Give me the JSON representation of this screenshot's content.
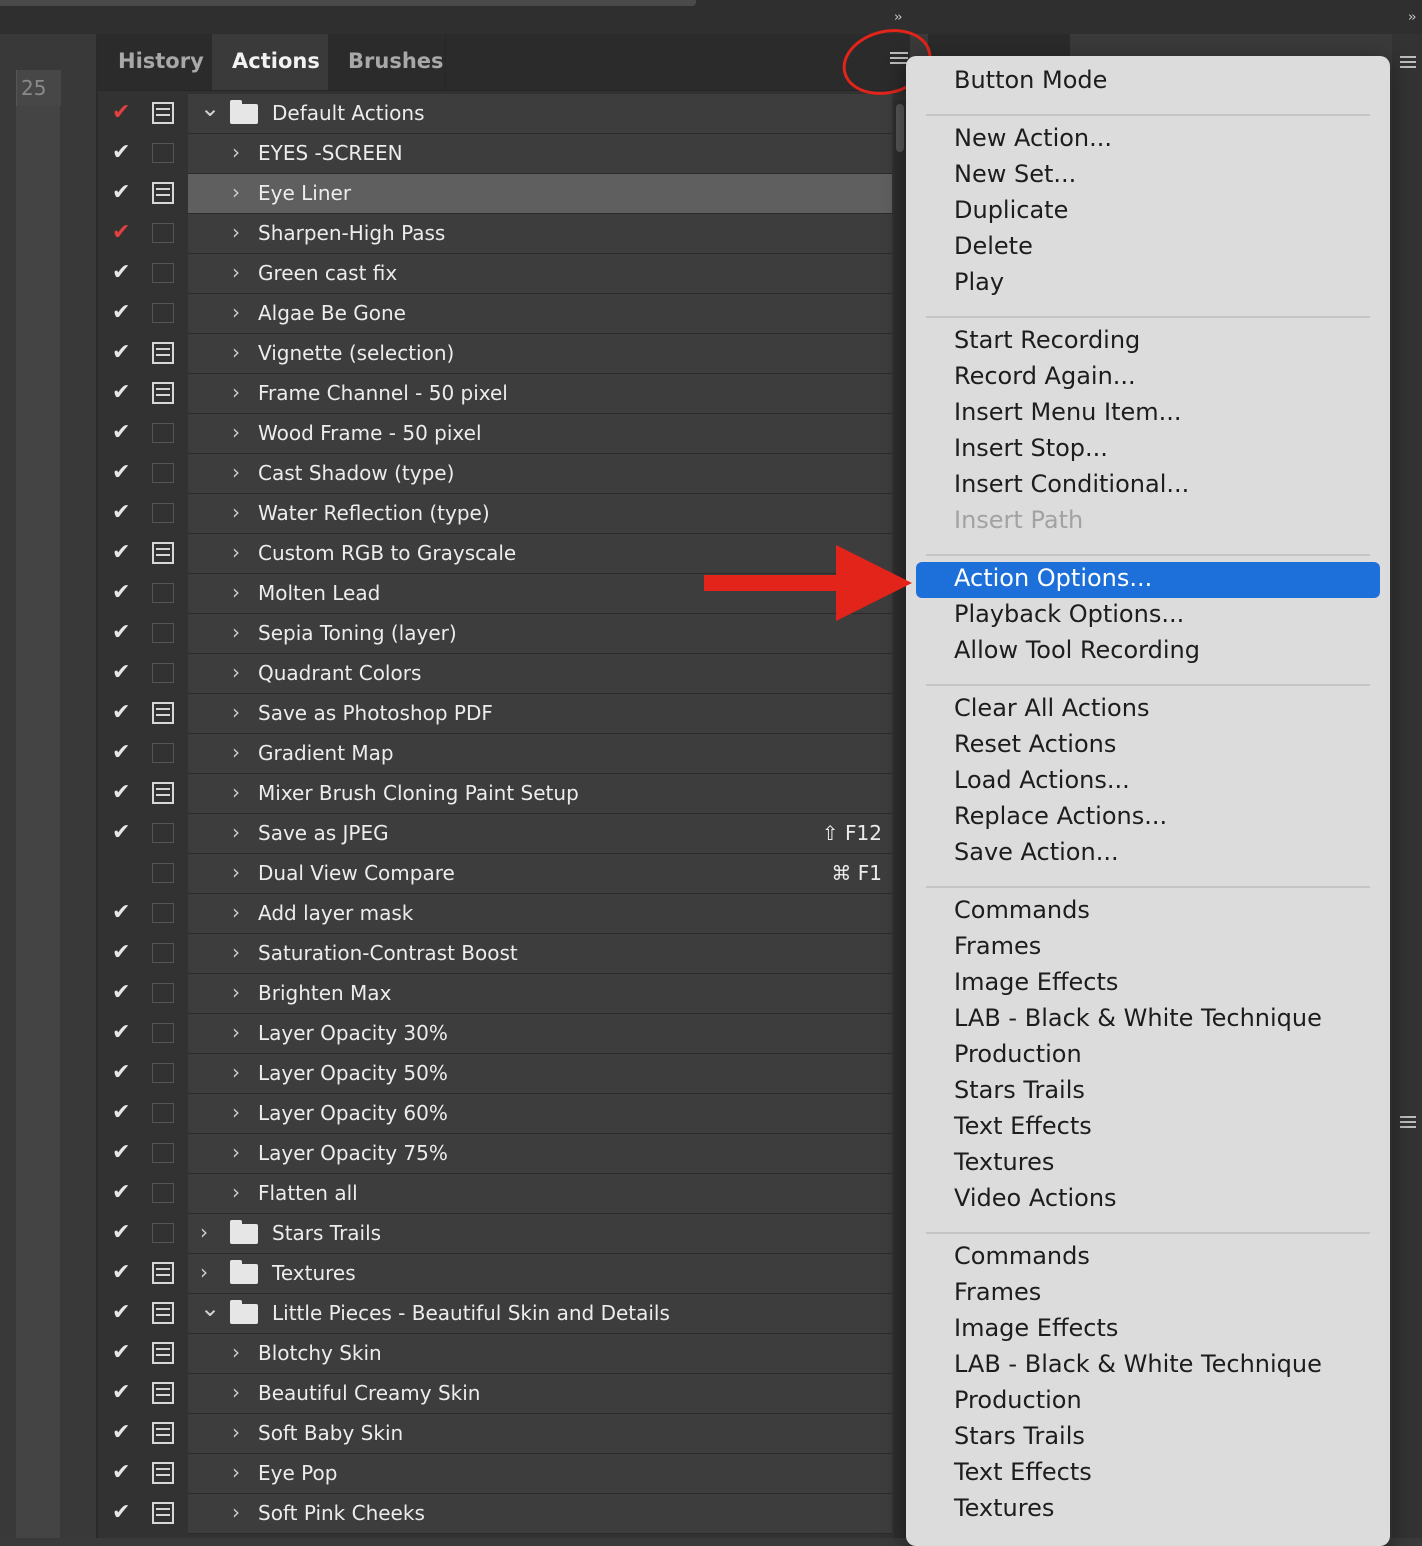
{
  "ruler": {
    "number": "25"
  },
  "tabs": [
    "History",
    "Actions",
    "Brushes"
  ],
  "actions": [
    {
      "label": "Default Actions",
      "check": "red",
      "dialog": true,
      "kind": "set",
      "open": true
    },
    {
      "label": "EYES -SCREEN",
      "check": "white",
      "dialog": false,
      "kind": "action"
    },
    {
      "label": "Eye Liner",
      "check": "white",
      "dialog": true,
      "kind": "action",
      "selected": true
    },
    {
      "label": "Sharpen-High Pass",
      "check": "red",
      "dialog": false,
      "kind": "action"
    },
    {
      "label": "Green cast fix",
      "check": "white",
      "dialog": false,
      "kind": "action"
    },
    {
      "label": "Algae Be Gone",
      "check": "white",
      "dialog": false,
      "kind": "action"
    },
    {
      "label": "Vignette (selection)",
      "check": "white",
      "dialog": true,
      "kind": "action"
    },
    {
      "label": "Frame Channel - 50 pixel",
      "check": "white",
      "dialog": true,
      "kind": "action"
    },
    {
      "label": "Wood Frame - 50 pixel",
      "check": "white",
      "dialog": false,
      "kind": "action"
    },
    {
      "label": "Cast Shadow (type)",
      "check": "white",
      "dialog": false,
      "kind": "action"
    },
    {
      "label": "Water Reflection (type)",
      "check": "white",
      "dialog": false,
      "kind": "action"
    },
    {
      "label": "Custom RGB to Grayscale",
      "check": "white",
      "dialog": true,
      "kind": "action"
    },
    {
      "label": "Molten Lead",
      "check": "white",
      "dialog": false,
      "kind": "action"
    },
    {
      "label": "Sepia Toning (layer)",
      "check": "white",
      "dialog": false,
      "kind": "action"
    },
    {
      "label": "Quadrant Colors",
      "check": "white",
      "dialog": false,
      "kind": "action"
    },
    {
      "label": "Save as Photoshop PDF",
      "check": "white",
      "dialog": true,
      "kind": "action"
    },
    {
      "label": "Gradient Map",
      "check": "white",
      "dialog": false,
      "kind": "action"
    },
    {
      "label": "Mixer Brush Cloning Paint Setup",
      "check": "white",
      "dialog": true,
      "kind": "action"
    },
    {
      "label": "Save as JPEG",
      "check": "white",
      "dialog": false,
      "kind": "action",
      "shortcut": "⇧ F12"
    },
    {
      "label": "Dual View Compare",
      "check": "none",
      "dialog": false,
      "kind": "action",
      "shortcut": "⌘ F1"
    },
    {
      "label": "Add layer mask",
      "check": "white",
      "dialog": false,
      "kind": "action"
    },
    {
      "label": "Saturation-Contrast Boost",
      "check": "white",
      "dialog": false,
      "kind": "action"
    },
    {
      "label": "Brighten Max",
      "check": "white",
      "dialog": false,
      "kind": "action"
    },
    {
      "label": "Layer Opacity 30%",
      "check": "white",
      "dialog": false,
      "kind": "action"
    },
    {
      "label": "Layer Opacity 50%",
      "check": "white",
      "dialog": false,
      "kind": "action"
    },
    {
      "label": "Layer Opacity 60%",
      "check": "white",
      "dialog": false,
      "kind": "action"
    },
    {
      "label": "Layer Opacity 75%",
      "check": "white",
      "dialog": false,
      "kind": "action"
    },
    {
      "label": "Flatten all",
      "check": "white",
      "dialog": false,
      "kind": "action"
    },
    {
      "label": "Stars Trails",
      "check": "white",
      "dialog": false,
      "kind": "set",
      "open": false
    },
    {
      "label": "Textures",
      "check": "white",
      "dialog": true,
      "kind": "set",
      "open": false
    },
    {
      "label": "Little Pieces - Beautiful Skin and Details",
      "check": "white",
      "dialog": true,
      "kind": "set",
      "open": true
    },
    {
      "label": "Blotchy Skin",
      "check": "white",
      "dialog": true,
      "kind": "action"
    },
    {
      "label": "Beautiful Creamy Skin",
      "check": "white",
      "dialog": true,
      "kind": "action"
    },
    {
      "label": "Soft Baby Skin",
      "check": "white",
      "dialog": true,
      "kind": "action"
    },
    {
      "label": "Eye Pop",
      "check": "white",
      "dialog": true,
      "kind": "action"
    },
    {
      "label": "Soft Pink Cheeks",
      "check": "white",
      "dialog": true,
      "kind": "action"
    }
  ],
  "menu": [
    {
      "label": "Button Mode"
    },
    {
      "sep": true
    },
    {
      "label": "New Action..."
    },
    {
      "label": "New Set..."
    },
    {
      "label": "Duplicate"
    },
    {
      "label": "Delete"
    },
    {
      "label": "Play"
    },
    {
      "sep": true
    },
    {
      "label": "Start Recording"
    },
    {
      "label": "Record Again..."
    },
    {
      "label": "Insert Menu Item..."
    },
    {
      "label": "Insert Stop..."
    },
    {
      "label": "Insert Conditional..."
    },
    {
      "label": "Insert Path",
      "disabled": true
    },
    {
      "sep": true
    },
    {
      "label": "Action Options...",
      "highlighted": true
    },
    {
      "label": "Playback Options..."
    },
    {
      "label": "Allow Tool Recording"
    },
    {
      "sep": true
    },
    {
      "label": "Clear All Actions"
    },
    {
      "label": "Reset Actions"
    },
    {
      "label": "Load Actions..."
    },
    {
      "label": "Replace Actions..."
    },
    {
      "label": "Save Action..."
    },
    {
      "sep": true
    },
    {
      "label": "Commands"
    },
    {
      "label": "Frames"
    },
    {
      "label": "Image Effects"
    },
    {
      "label": "LAB - Black & White Technique"
    },
    {
      "label": "Production"
    },
    {
      "label": "Stars Trails"
    },
    {
      "label": "Text Effects"
    },
    {
      "label": "Textures"
    },
    {
      "label": "Video Actions"
    },
    {
      "sep": true
    },
    {
      "label": "Commands"
    },
    {
      "label": "Frames"
    },
    {
      "label": "Image Effects"
    },
    {
      "label": "LAB - Black & White Technique"
    },
    {
      "label": "Production"
    },
    {
      "label": "Stars Trails"
    },
    {
      "label": "Text Effects"
    },
    {
      "label": "Textures"
    }
  ],
  "colors": {
    "highlight": "#1d6fd9",
    "annotation": "#e3241b",
    "check_red": "#e04040"
  }
}
